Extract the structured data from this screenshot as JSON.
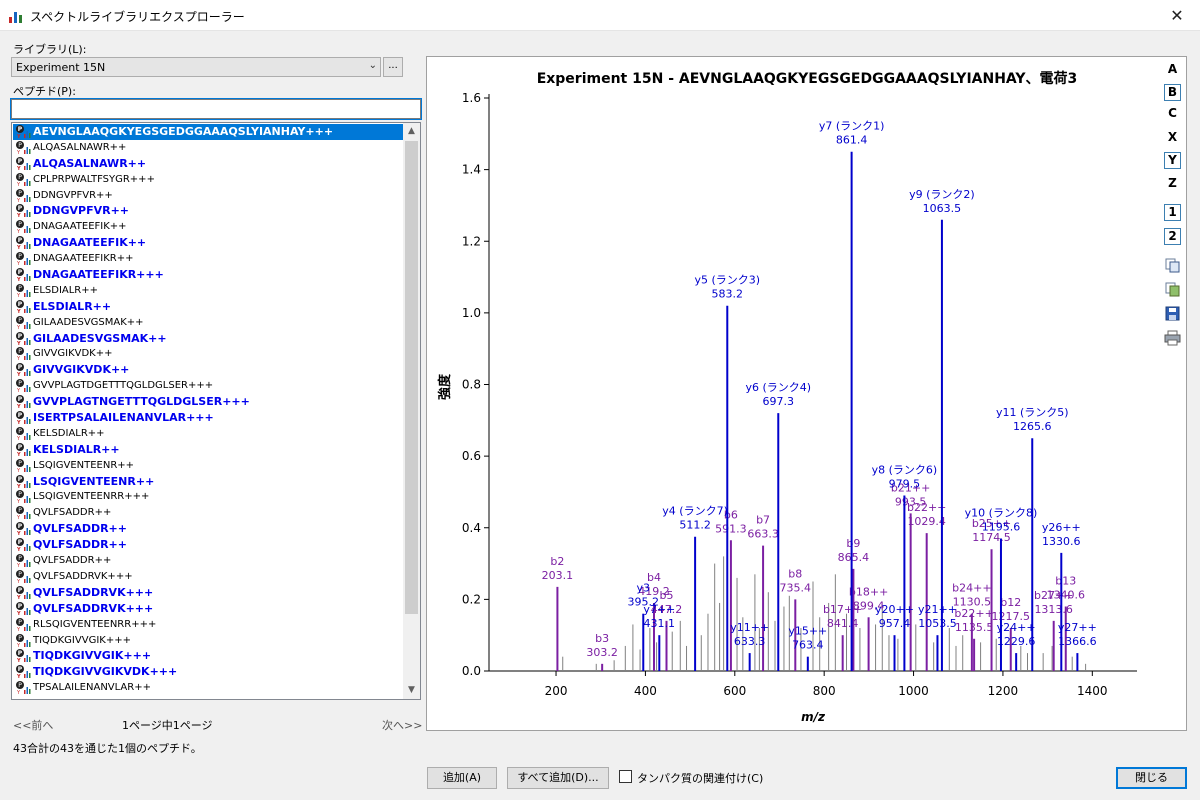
{
  "window": {
    "title": "スペクトルライブラリエクスプローラー",
    "close": "✕"
  },
  "library": {
    "label": "ライブラリ(L):",
    "value": "Experiment 15N",
    "browse": "..."
  },
  "peptide": {
    "label": "ペプチド(P):",
    "value": ""
  },
  "peptides": [
    {
      "text": "AEVNGLAAQGKYEGSGEDGGAAAQSLYIANHAY+++",
      "bold": true,
      "selected": true
    },
    {
      "text": "ALQASALNAWR++",
      "bold": false
    },
    {
      "text": "ALQASALNAWR++",
      "bold": true
    },
    {
      "text": "CPLPRPWALTFSYGR+++",
      "bold": false
    },
    {
      "text": "DDNGVPFVR++",
      "bold": false
    },
    {
      "text": "DDNGVPFVR++",
      "bold": true
    },
    {
      "text": "DNAGAATEEFIK++",
      "bold": false
    },
    {
      "text": "DNAGAATEEFIK++",
      "bold": true
    },
    {
      "text": "DNAGAATEEFIKR++",
      "bold": false
    },
    {
      "text": "DNAGAATEEFIKR+++",
      "bold": true
    },
    {
      "text": "ELSDIALR++",
      "bold": false
    },
    {
      "text": "ELSDIALR++",
      "bold": true
    },
    {
      "text": "GILAADESVGSMAK++",
      "bold": false
    },
    {
      "text": "GILAADESVGSMAK++",
      "bold": true
    },
    {
      "text": "GIVVGIKVDK++",
      "bold": false
    },
    {
      "text": "GIVVGIKVDK++",
      "bold": true
    },
    {
      "text": "GVVPLAGTDGETTTQGLDGLSER+++",
      "bold": false
    },
    {
      "text": "GVVPLAGTNGETTTQGLDGLSER+++",
      "bold": true
    },
    {
      "text": "ISERTPSALAILENANVLAR+++",
      "bold": true
    },
    {
      "text": "KELSDIALR++",
      "bold": false
    },
    {
      "text": "KELSDIALR++",
      "bold": true
    },
    {
      "text": "LSQIGVENTEENR++",
      "bold": false
    },
    {
      "text": "LSQIGVENTEENR++",
      "bold": true
    },
    {
      "text": "LSQIGVENTEENRR+++",
      "bold": false
    },
    {
      "text": "QVLFSADDR++",
      "bold": false
    },
    {
      "text": "QVLFSADDR++",
      "bold": true
    },
    {
      "text": "QVLFSADDR++",
      "bold": true
    },
    {
      "text": "QVLFSADDR++",
      "bold": false
    },
    {
      "text": "QVLFSADDRVK+++",
      "bold": false
    },
    {
      "text": "QVLFSADDRVK+++",
      "bold": true
    },
    {
      "text": "QVLFSADDRVK+++",
      "bold": true
    },
    {
      "text": "RLSQIGVENTEENRR+++",
      "bold": false
    },
    {
      "text": "TIQDKGIVVGIK+++",
      "bold": false
    },
    {
      "text": "TIQDKGIVVGIK+++",
      "bold": true
    },
    {
      "text": "TIQDKGIVVGIKVDK+++",
      "bold": true
    },
    {
      "text": "TPSALAILENANVLAR++",
      "bold": false
    }
  ],
  "pager": {
    "prev": "<<前へ",
    "info": "1ページ中1ページ",
    "next": "次へ>>"
  },
  "status": "43合計の43を通じた1個のペプチド。",
  "buttons": {
    "add": "追加(A)",
    "add_all": "すべて追加(D)...",
    "assoc": "タンパク質の関連付け(C)",
    "close": "閉じる"
  },
  "side_buttons": [
    "A",
    "B",
    "C",
    "X",
    "Y",
    "Z",
    "1",
    "2"
  ],
  "side_buttons_boxed": [
    "B",
    "Y",
    "1",
    "2"
  ],
  "colors": {
    "y_ion": "#0000cc",
    "b_ion": "#7b1fa2",
    "unmatched": "#808080",
    "selection": "#0078d7",
    "peptide_link": "#0000ee"
  },
  "chart_data": {
    "type": "bar",
    "title": "Experiment  15N  -  AEVNGLAAQGKYEGSGEDGGAAAQSLYIANHAY、電荷3",
    "xlabel": "m/z",
    "ylabel": "強度",
    "xlim": [
      50,
      1500
    ],
    "ylim": [
      0,
      1.6
    ],
    "xticks": [
      200,
      400,
      600,
      800,
      1000,
      1200,
      1400
    ],
    "yticks": [
      "0.0",
      "0.2",
      "0.4",
      "0.6",
      "0.8",
      "1.0",
      "1.2",
      "1.4",
      "1.6"
    ],
    "y_ions": [
      {
        "x": 861.4,
        "y": 1.45,
        "label": "y7 (ランク1)",
        "mz": "861.4"
      },
      {
        "x": 1063.5,
        "y": 1.26,
        "label": "y9 (ランク2)",
        "mz": "1063.5"
      },
      {
        "x": 583.2,
        "y": 1.02,
        "label": "y5 (ランク3)",
        "mz": "583.2"
      },
      {
        "x": 697.3,
        "y": 0.72,
        "label": "y6 (ランク4)",
        "mz": "697.3"
      },
      {
        "x": 1265.6,
        "y": 0.65,
        "label": "y11 (ランク5)",
        "mz": "1265.6"
      },
      {
        "x": 979.5,
        "y": 0.49,
        "label": "y8 (ランク6)",
        "mz": "979.5"
      },
      {
        "x": 511.2,
        "y": 0.375,
        "label": "y4 (ランク7)",
        "mz": "511.2"
      },
      {
        "x": 1195.6,
        "y": 0.37,
        "label": "y10 (ランク8)",
        "mz": "1195.6"
      },
      {
        "x": 1330.6,
        "y": 0.33,
        "label": "y26++",
        "mz": "1330.6"
      },
      {
        "x": 395.2,
        "y": 0.16,
        "label": "y3",
        "mz": "395.2"
      },
      {
        "x": 431.1,
        "y": 0.1,
        "label": "y7++",
        "mz": "431.1"
      },
      {
        "x": 633.3,
        "y": 0.05,
        "label": "y11++",
        "mz": "633.3"
      },
      {
        "x": 763.4,
        "y": 0.04,
        "label": "y15++",
        "mz": "763.4"
      },
      {
        "x": 957.4,
        "y": 0.1,
        "label": "y20++",
        "mz": "957.4"
      },
      {
        "x": 1053.5,
        "y": 0.1,
        "label": "y21++",
        "mz": "1053.5"
      },
      {
        "x": 1229.6,
        "y": 0.05,
        "label": "y24++",
        "mz": "1229.6"
      },
      {
        "x": 1366.6,
        "y": 0.05,
        "label": "y27++",
        "mz": "1366.6"
      }
    ],
    "b_ions": [
      {
        "x": 203.1,
        "y": 0.235,
        "label": "b2",
        "mz": "203.1"
      },
      {
        "x": 303.2,
        "y": 0.02,
        "label": "b3",
        "mz": "303.2"
      },
      {
        "x": 419.2,
        "y": 0.19,
        "label": "b4",
        "mz": "419.2"
      },
      {
        "x": 447.2,
        "y": 0.14,
        "label": "b5",
        "mz": "447.2"
      },
      {
        "x": 591.3,
        "y": 0.365,
        "label": "b6",
        "mz": "591.3"
      },
      {
        "x": 663.3,
        "y": 0.35,
        "label": "b7",
        "mz": "663.3"
      },
      {
        "x": 735.4,
        "y": 0.2,
        "label": "b8",
        "mz": "735.4"
      },
      {
        "x": 841.4,
        "y": 0.1,
        "label": "b17++",
        "mz": "841.4"
      },
      {
        "x": 865.4,
        "y": 0.285,
        "label": "b9",
        "mz": "865.4"
      },
      {
        "x": 899.4,
        "y": 0.15,
        "label": "b18++",
        "mz": "899.4"
      },
      {
        "x": 993.5,
        "y": 0.44,
        "label": "b21++",
        "mz": "993.5"
      },
      {
        "x": 1029.4,
        "y": 0.385,
        "label": "b22++",
        "mz": "1029.4"
      },
      {
        "x": 1130.5,
        "y": 0.16,
        "label": "b24++",
        "mz": "1130.5"
      },
      {
        "x": 1135.5,
        "y": 0.09,
        "label": "b22++",
        "mz": "1135.5"
      },
      {
        "x": 1174.5,
        "y": 0.34,
        "label": "b25++",
        "mz": "1174.5"
      },
      {
        "x": 1217.5,
        "y": 0.12,
        "label": "b12",
        "mz": "1217.5"
      },
      {
        "x": 1313.6,
        "y": 0.14,
        "label": "b27++",
        "mz": "1313.6"
      },
      {
        "x": 1340.6,
        "y": 0.18,
        "label": "b13",
        "mz": "1340.6"
      }
    ],
    "unmatched": [
      {
        "x": 215,
        "y": 0.04
      },
      {
        "x": 290,
        "y": 0.02
      },
      {
        "x": 330,
        "y": 0.03
      },
      {
        "x": 355,
        "y": 0.07
      },
      {
        "x": 372,
        "y": 0.13
      },
      {
        "x": 388,
        "y": 0.06
      },
      {
        "x": 410,
        "y": 0.12
      },
      {
        "x": 425,
        "y": 0.08
      },
      {
        "x": 460,
        "y": 0.11
      },
      {
        "x": 478,
        "y": 0.14
      },
      {
        "x": 492,
        "y": 0.07
      },
      {
        "x": 525,
        "y": 0.1
      },
      {
        "x": 540,
        "y": 0.16
      },
      {
        "x": 555,
        "y": 0.3
      },
      {
        "x": 566,
        "y": 0.19
      },
      {
        "x": 575,
        "y": 0.32
      },
      {
        "x": 605,
        "y": 0.26
      },
      {
        "x": 618,
        "y": 0.15
      },
      {
        "x": 645,
        "y": 0.27
      },
      {
        "x": 655,
        "y": 0.12
      },
      {
        "x": 675,
        "y": 0.22
      },
      {
        "x": 690,
        "y": 0.14
      },
      {
        "x": 710,
        "y": 0.18
      },
      {
        "x": 722,
        "y": 0.21
      },
      {
        "x": 748,
        "y": 0.12
      },
      {
        "x": 775,
        "y": 0.25
      },
      {
        "x": 790,
        "y": 0.15
      },
      {
        "x": 810,
        "y": 0.19
      },
      {
        "x": 825,
        "y": 0.27
      },
      {
        "x": 850,
        "y": 0.16
      },
      {
        "x": 880,
        "y": 0.12
      },
      {
        "x": 915,
        "y": 0.13
      },
      {
        "x": 930,
        "y": 0.18
      },
      {
        "x": 945,
        "y": 0.1
      },
      {
        "x": 965,
        "y": 0.09
      },
      {
        "x": 1005,
        "y": 0.13
      },
      {
        "x": 1045,
        "y": 0.08
      },
      {
        "x": 1080,
        "y": 0.12
      },
      {
        "x": 1095,
        "y": 0.07
      },
      {
        "x": 1110,
        "y": 0.1
      },
      {
        "x": 1150,
        "y": 0.08
      },
      {
        "x": 1185,
        "y": 0.09
      },
      {
        "x": 1240,
        "y": 0.07
      },
      {
        "x": 1255,
        "y": 0.05
      },
      {
        "x": 1290,
        "y": 0.05
      },
      {
        "x": 1310,
        "y": 0.07
      },
      {
        "x": 1355,
        "y": 0.04
      },
      {
        "x": 1385,
        "y": 0.02
      }
    ]
  }
}
